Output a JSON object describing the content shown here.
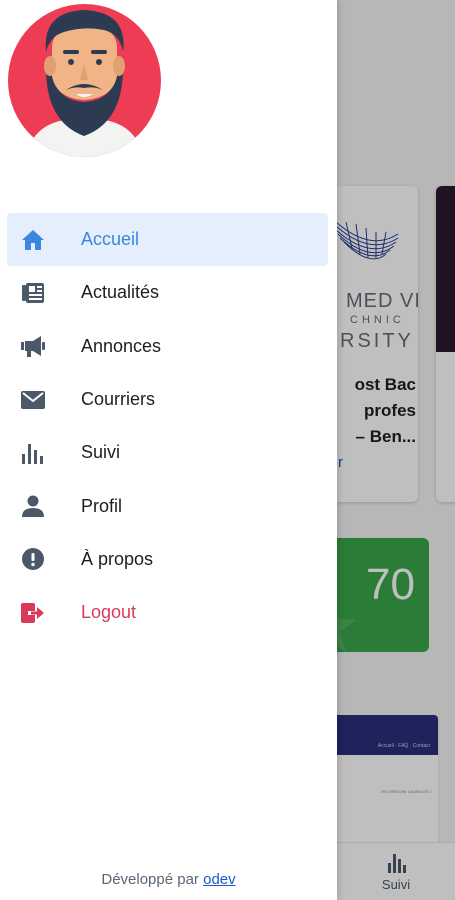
{
  "colors": {
    "accent": "#3a86e0",
    "active_bg": "#e5eefc",
    "icon_gray": "#4a5868",
    "logout": "#d93a5a",
    "avatar_bg": "#ee3c54",
    "link": "#1a5ac8",
    "stat_tile": "#3aa64a"
  },
  "drawer": {
    "avatar_icon": "user-avatar-bearded-man",
    "menu": [
      {
        "label": "Accueil",
        "icon": "home-icon",
        "active": true
      },
      {
        "label": "Actualités",
        "icon": "newspaper-icon",
        "active": false
      },
      {
        "label": "Annonces",
        "icon": "megaphone-icon",
        "active": false
      },
      {
        "label": "Courriers",
        "icon": "envelope-icon",
        "active": false
      },
      {
        "label": "Suivi",
        "icon": "bar-chart-icon",
        "active": false
      },
      {
        "label": "Profil",
        "icon": "user-icon",
        "active": false
      },
      {
        "label": "À propos",
        "icon": "info-exclamation-icon",
        "active": false
      },
      {
        "label": "Logout",
        "icon": "logout-icon",
        "active": false
      }
    ],
    "footer": {
      "prefix": "Développé par",
      "link_text": "odev"
    }
  },
  "background": {
    "news_card": {
      "image_lines": [
        "MED VI",
        "CHNIC",
        "RSITY"
      ],
      "title_lines": [
        "ost Bac",
        "profes",
        "– Ben..."
      ],
      "link_text": "r"
    },
    "stat_tile": {
      "value": "70"
    },
    "thumbnail": {
      "header_text": "Accueil · FAQ · Contact",
      "sub_text": "RECHERCHE LAUREATE >"
    },
    "bottom_tab": {
      "label": "Suivi",
      "icon": "bar-chart-icon"
    }
  }
}
